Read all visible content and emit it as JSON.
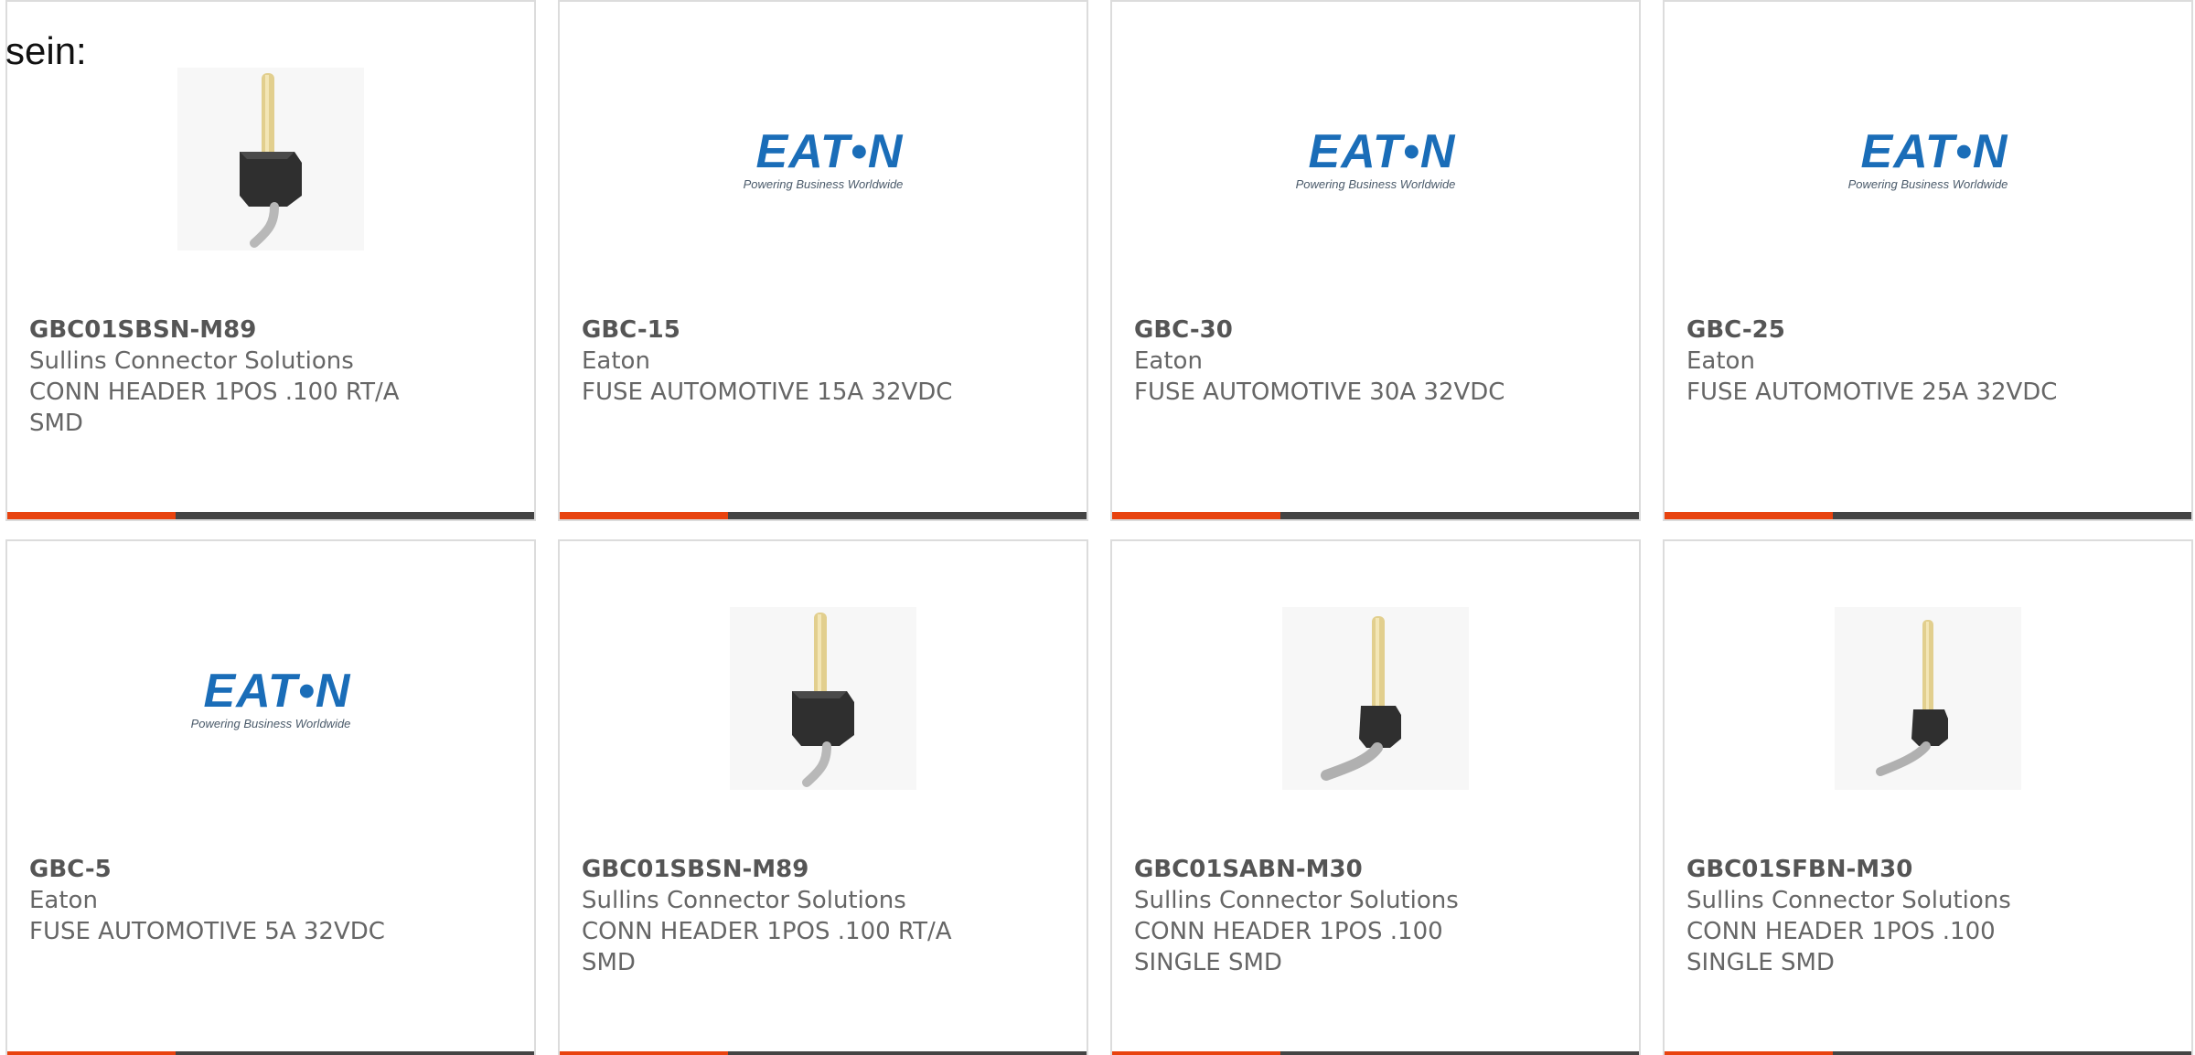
{
  "intro_text": "sein:",
  "brand": {
    "accent_color": "#e8430f",
    "bar_color": "#444444",
    "eaton_blue": "#1a6db8"
  },
  "products": [
    {
      "part_number": "GBC01SBSN-M89",
      "manufacturer": "Sullins Connector Solutions",
      "description": "CONN HEADER 1POS .100 RT/A SMD",
      "image": "connector-header-image"
    },
    {
      "part_number": "GBC-15",
      "manufacturer": "Eaton",
      "description": "FUSE AUTOMOTIVE 15A 32VDC",
      "image": "eaton-logo",
      "logo_word": "EAT•N",
      "logo_tagline": "Powering Business Worldwide"
    },
    {
      "part_number": "GBC-30",
      "manufacturer": "Eaton",
      "description": "FUSE AUTOMOTIVE 30A 32VDC",
      "image": "eaton-logo",
      "logo_word": "EAT•N",
      "logo_tagline": "Powering Business Worldwide"
    },
    {
      "part_number": "GBC-25",
      "manufacturer": "Eaton",
      "description": "FUSE AUTOMOTIVE 25A 32VDC",
      "image": "eaton-logo",
      "logo_word": "EAT•N",
      "logo_tagline": "Powering Business Worldwide"
    },
    {
      "part_number": "GBC-5",
      "manufacturer": "Eaton",
      "description": "FUSE AUTOMOTIVE 5A 32VDC",
      "image": "eaton-logo",
      "logo_word": "EAT•N",
      "logo_tagline": "Powering Business Worldwide"
    },
    {
      "part_number": "GBC01SBSN-M89",
      "manufacturer": "Sullins Connector Solutions",
      "description": "CONN HEADER 1POS .100 RT/A SMD",
      "image": "connector-header-image"
    },
    {
      "part_number": "GBC01SABN-M30",
      "manufacturer": "Sullins Connector Solutions",
      "description": "CONN HEADER 1POS .100 SINGLE SMD",
      "image": "connector-header-angled-image"
    },
    {
      "part_number": "GBC01SFBN-M30",
      "manufacturer": "Sullins Connector Solutions",
      "description": "CONN HEADER 1POS .100 SINGLE SMD",
      "image": "connector-header-angled-image"
    }
  ]
}
